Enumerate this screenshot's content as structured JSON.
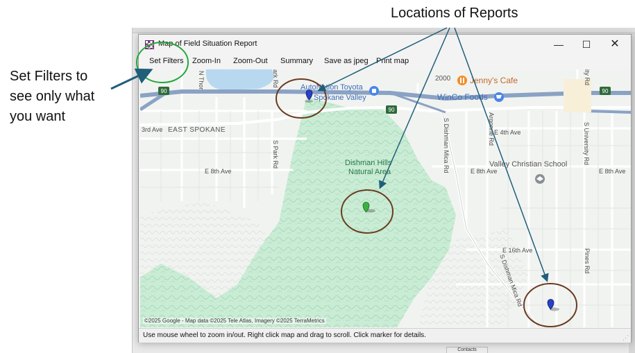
{
  "callouts": {
    "filters_line1": "Set Filters to",
    "filters_line2": "see only what",
    "filters_line3": "you want",
    "reports": "Locations of Reports"
  },
  "window": {
    "title": "Map of Field Situation Report",
    "controls": {
      "minimize": "—",
      "maximize": "☐",
      "close": "✕"
    }
  },
  "menu": [
    "Set Filters",
    "Zoom-In",
    "Zoom-Out",
    "Summary",
    "Save as jpeg",
    "Print map"
  ],
  "map": {
    "labels": {
      "autonation": "AutoNation Toyota",
      "spokane_valley": "Spokane Valley",
      "jennys_cafe": "Jenny's Cafe",
      "winco": "WinCo Foods",
      "east_spokane": "EAST SPOKANE",
      "ave_3rd": "3rd Ave",
      "e_4th_ave": "E 4th Ave",
      "e_8th_ave_left": "E 8th Ave",
      "e_8th_ave_mid": "E 8th Ave",
      "e_8th_ave_right": "E 8th Ave",
      "e_16th_ave": "E 16th Ave",
      "dishman_hills": "Dishman Hills",
      "natural_area": "Natural Area",
      "valley_christian": "Valley Christian School",
      "n_thor": "N Thor",
      "s_park_rd": "S Park Rd",
      "park_rd_top": "ark Rd",
      "s_dishman_mica_top": "S Dishman Mica Rd",
      "s_dishman_mica_bottom": "S Dishman Mica Rd",
      "s_argonne_rd": "Argonne Rd",
      "s_university_rd": "S University Rd",
      "university_rd_top": "ity Rd",
      "s_pines_rd": "Pines Rd",
      "number_2000": "2000",
      "shield_90_left": "90",
      "shield_90_mid": "90",
      "shield_90_right": "90"
    },
    "attribution": "©2025 Google - Map data ©2025 Tele Atlas, Imagery ©2025 TerraMetrics"
  },
  "status": "Use mouse wheel to zoom in/out.  Right click map and drag to scroll.   Click marker for details.",
  "background": {
    "tab_label": "Contacts"
  },
  "colors": {
    "forest": "#c9ecd5",
    "forest_dark": "#9fd8b3",
    "highway": "#8aa2c4",
    "road": "#ffffff",
    "marker_blue": "#2b3fc7",
    "marker_green": "#3cb043",
    "circle_brown": "#6b3a1f",
    "circle_green": "#22a83a",
    "arrow": "#1f5f7a"
  }
}
